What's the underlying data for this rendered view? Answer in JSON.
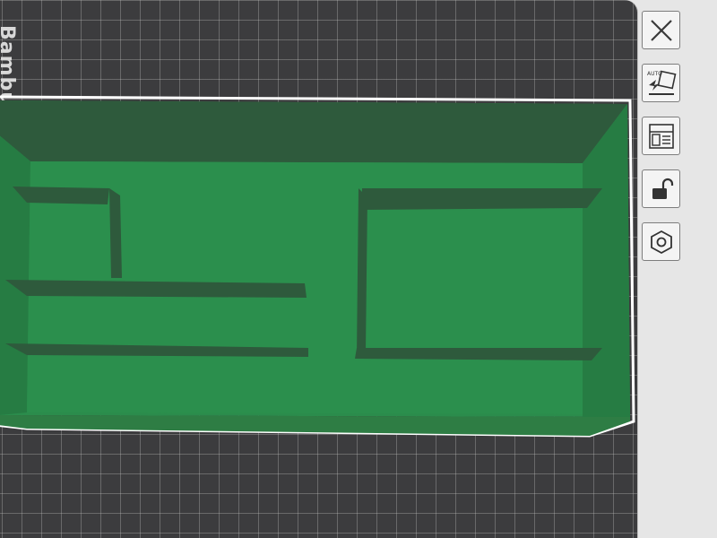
{
  "plate": {
    "brand_label": "Bambu"
  },
  "toolbar": {
    "auto_orient_label": "AUTO",
    "tools": [
      {
        "name": "close",
        "icon": "close-icon"
      },
      {
        "name": "auto-orient",
        "icon": "auto-orient-icon"
      },
      {
        "name": "arrange",
        "icon": "arrange-icon"
      },
      {
        "name": "lock",
        "icon": "unlock-icon"
      },
      {
        "name": "settings",
        "icon": "hexagon-nut-icon"
      }
    ]
  },
  "colors": {
    "plate": "#3c3c3e",
    "model_floor": "#2b8c4c",
    "model_wall_dark": "#2e5a3c",
    "model_wall_mid": "#267c43",
    "selection_outline": "#ffffff",
    "toolbar_bg": "#e9e9e9"
  }
}
